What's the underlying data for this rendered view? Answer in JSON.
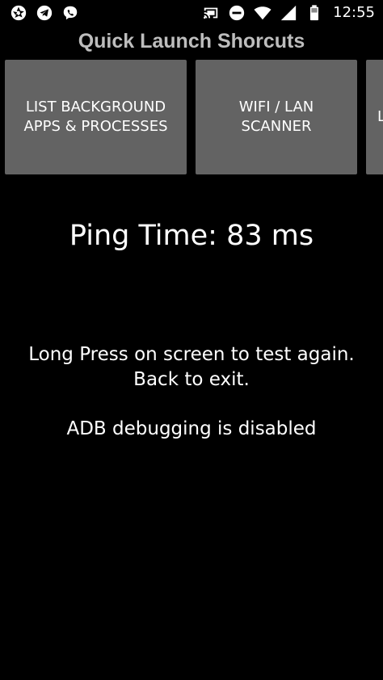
{
  "status_bar": {
    "time": "12:55",
    "left_icons": [
      "aperture-icon",
      "telegram-icon",
      "viber-icon"
    ],
    "right_icons": [
      "cast-icon",
      "do-not-disturb-icon",
      "wifi-icon",
      "signal-icon",
      "battery-icon"
    ]
  },
  "app": {
    "title": "Quick Launch Shorcuts"
  },
  "shortcuts": [
    {
      "label": "LIST BACKGROUND\nAPPS & PROCESSES"
    },
    {
      "label": "WIFI / LAN\nSCANNER"
    },
    {
      "label": "L"
    }
  ],
  "main": {
    "ping_text": "Ping Time: 83 ms",
    "instructions_line1": "Long Press on screen to test again.",
    "instructions_line2": "Back to exit.",
    "adb_status": "ADB debugging is disabled"
  },
  "colors": {
    "background": "#000000",
    "title": "#bdbdbd",
    "shortcut_bg": "#636363",
    "text": "#ffffff"
  }
}
